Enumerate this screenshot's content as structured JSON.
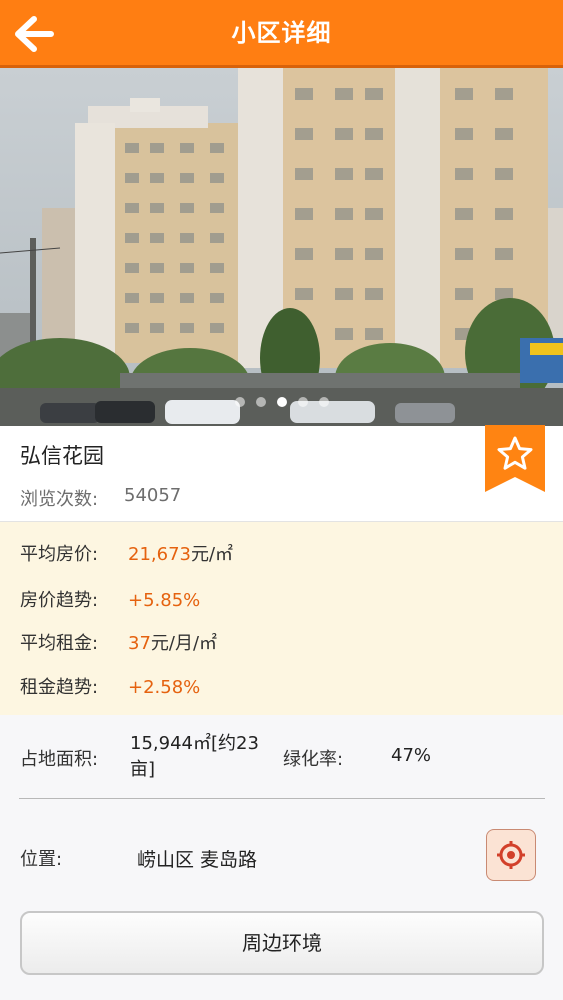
{
  "header": {
    "title": "小区详细"
  },
  "gallery": {
    "dot_count": 5,
    "active_index": 3
  },
  "community": {
    "name": "弘信花园",
    "views_label": "浏览次数:",
    "views_value": "54057"
  },
  "prices": {
    "avg_price_label": "平均房价:",
    "avg_price_value": "21,673",
    "avg_price_unit": "元/㎡",
    "price_trend_label": "房价趋势:",
    "price_trend_value": "+5.85%",
    "avg_rent_label": "平均租金:",
    "avg_rent_value": "37",
    "avg_rent_unit": "元/月/㎡",
    "rent_trend_label": "租金趋势:",
    "rent_trend_value": "+2.58%"
  },
  "details": {
    "area_label": "占地面积:",
    "area_value": "15,944㎡[约23亩]",
    "green_label": "绿化率:",
    "green_value": "47%"
  },
  "location": {
    "label": "位置:",
    "value": "崂山区  麦岛路"
  },
  "nearby_button": "周边环境",
  "colors": {
    "header": "#ff7e12",
    "accent_text": "#e5620f",
    "price_panel_bg": "#fdf6e1"
  },
  "icons": {
    "back": "arrow-left-icon",
    "favorite": "star-icon",
    "locate": "target-icon"
  }
}
